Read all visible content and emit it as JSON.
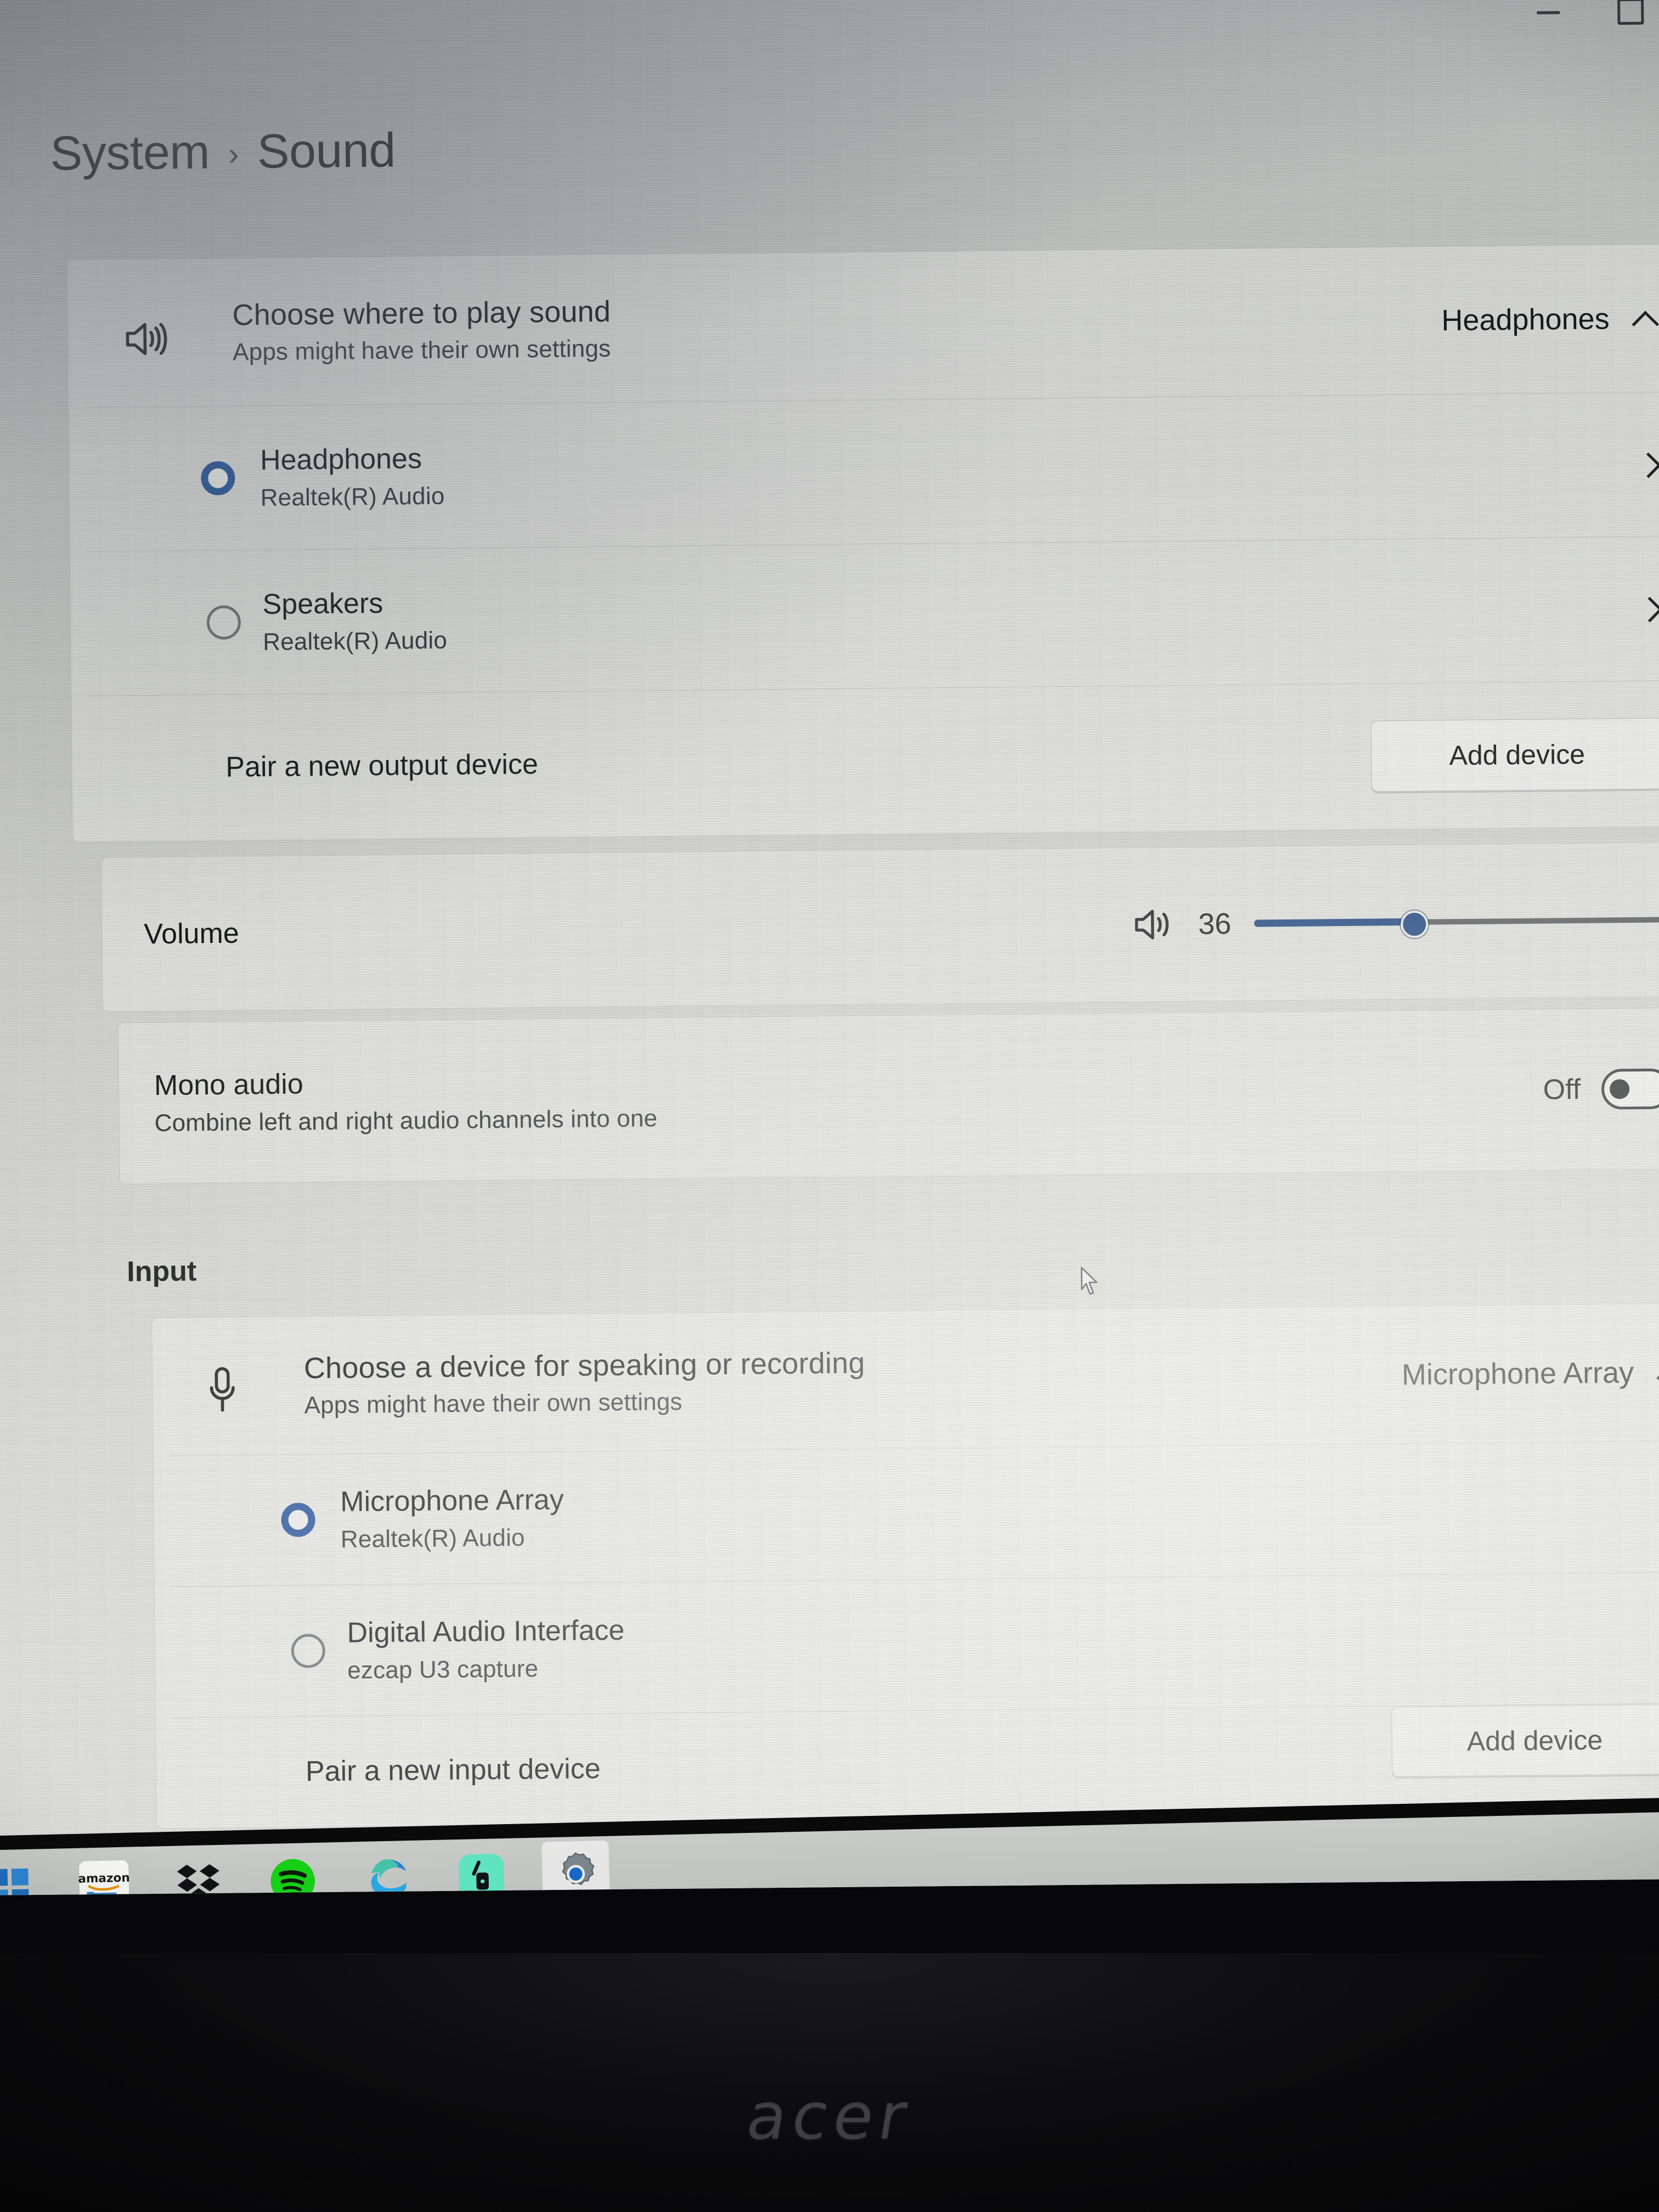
{
  "window": {
    "minimize_label": "Minimize",
    "maximize_label": "Maximize"
  },
  "breadcrumb": {
    "parent": "System",
    "separator": "›",
    "current": "Sound"
  },
  "output": {
    "chooser": {
      "title": "Choose where to play sound",
      "subtitle": "Apps might have their own settings",
      "selected_value": "Headphones",
      "expanded": true,
      "icon": "speaker-icon"
    },
    "devices": [
      {
        "name": "Headphones",
        "detail": "Realtek(R) Audio",
        "selected": true
      },
      {
        "name": "Speakers",
        "detail": "Realtek(R) Audio",
        "selected": false
      }
    ],
    "pair": {
      "label": "Pair a new output device",
      "button": "Add device"
    },
    "volume": {
      "label": "Volume",
      "value": "36",
      "percent": 36,
      "icon": "speaker-icon"
    },
    "mono": {
      "title": "Mono audio",
      "subtitle": "Combine left and right audio channels into one",
      "state": "Off",
      "on": false
    }
  },
  "input": {
    "heading": "Input",
    "chooser": {
      "title": "Choose a device for speaking or recording",
      "subtitle": "Apps might have their own settings",
      "selected_value": "Microphone Array",
      "expanded": true,
      "icon": "microphone-icon"
    },
    "devices": [
      {
        "name": "Microphone Array",
        "detail": "Realtek(R) Audio",
        "selected": true
      },
      {
        "name": "Digital Audio Interface",
        "detail": "ezcap U3 capture",
        "selected": false
      }
    ],
    "pair": {
      "label": "Pair a new input device",
      "button": "Add device"
    }
  },
  "taskbar": {
    "items": [
      {
        "name": "start-button",
        "icon": "windows-logo-icon",
        "running": false,
        "active": false
      },
      {
        "name": "amazon-shopping",
        "icon": "amazon-icon",
        "running": false,
        "active": false
      },
      {
        "name": "dropbox",
        "icon": "dropbox-icon",
        "running": false,
        "active": false
      },
      {
        "name": "spotify",
        "icon": "spotify-icon",
        "running": true,
        "active": false
      },
      {
        "name": "microsoft-edge",
        "icon": "edge-icon",
        "running": true,
        "active": false
      },
      {
        "name": "teal-app",
        "icon": "app-icon",
        "running": true,
        "active": false
      },
      {
        "name": "settings",
        "icon": "gear-icon",
        "running": true,
        "active": true
      }
    ]
  },
  "hardware": {
    "brand": "acer"
  },
  "colors": {
    "accent": "#17407e",
    "radio_selected": "#1b4e9b",
    "track": "#56585b",
    "page_bg": "#cfd0cd"
  }
}
